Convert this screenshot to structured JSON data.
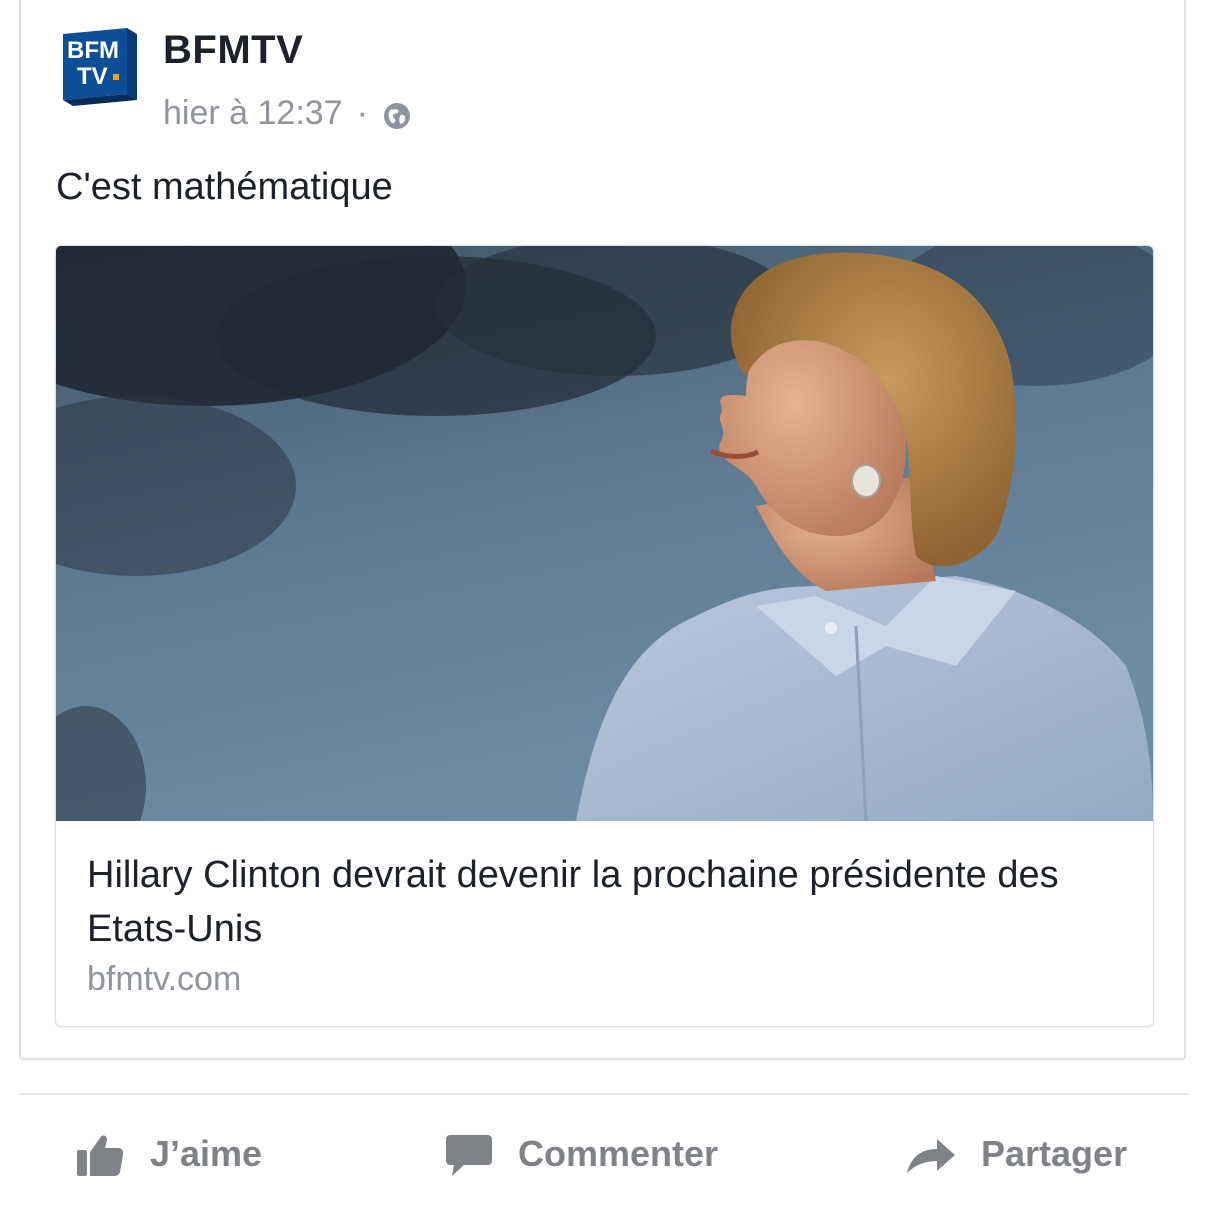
{
  "post": {
    "page_name": "BFMTV",
    "logo_text_top": "BFM",
    "logo_text_bottom": "TV",
    "timestamp": "hier à 12:37",
    "separator": "·",
    "audience_icon": "globe-icon",
    "text": "C'est mathématique"
  },
  "link_preview": {
    "title": "Hillary Clinton devrait devenir la prochaine présidente des Etats-Unis",
    "domain": "bfmtv.com"
  },
  "actions": {
    "like_label": "J’aime",
    "like_icon": "thumbs-up-icon",
    "comment_label": "Commenter",
    "comment_icon": "speech-bubble-icon",
    "share_label": "Partager",
    "share_icon": "share-arrow-icon"
  },
  "colors": {
    "logo_blue": "#0d4f97",
    "logo_accent": "#e8a020",
    "text_primary": "#1d2129",
    "text_secondary": "#90949c",
    "action_gray": "#7f8287"
  }
}
